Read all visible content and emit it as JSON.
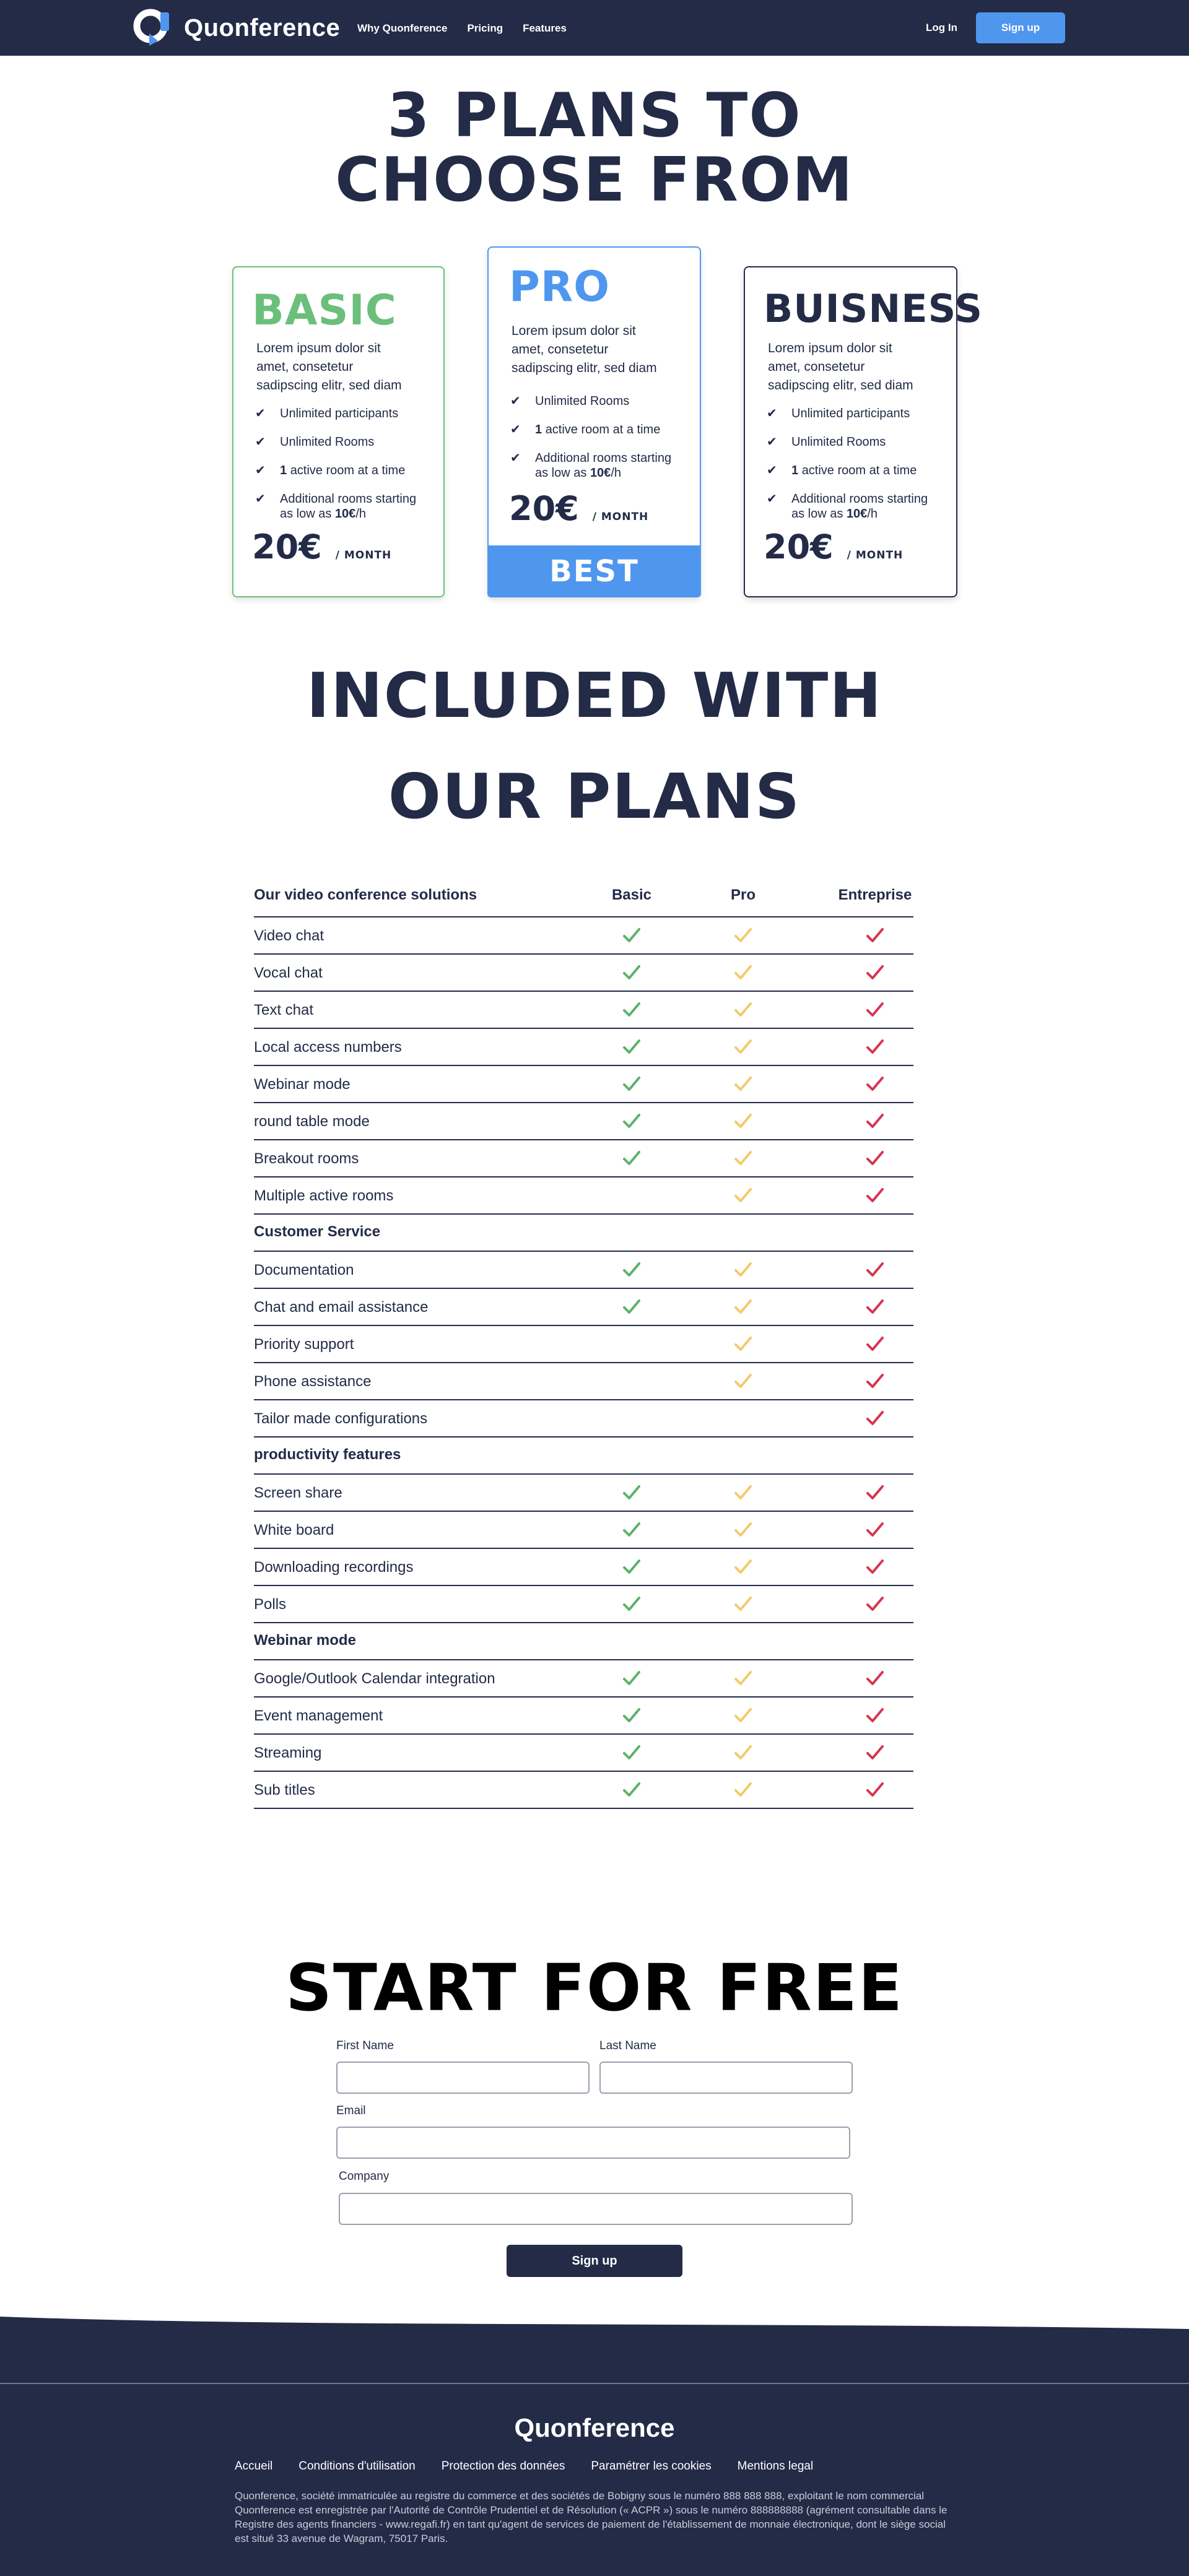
{
  "header": {
    "brand": "Quonference",
    "nav": [
      "Why Quonference",
      "Pricing",
      "Features"
    ],
    "login": "Log In",
    "signup": "Sign up"
  },
  "plans_title": [
    "3 PLANS TO",
    "CHOOSE FROM"
  ],
  "plans": [
    {
      "name": "BASIC",
      "color": "#6bbf7b",
      "desc": [
        "Lorem ipsum dolor sit",
        "amet, consetetur",
        "sadipscing elitr, sed diam"
      ],
      "features": [
        "Unlimited participants",
        "Unlimited Rooms",
        "active room at a time",
        "Additional rooms starting",
        "as low as",
        "/h"
      ],
      "bold_one": "1",
      "bold_price": "10€",
      "price": "20€",
      "per": "/ MONTH"
    },
    {
      "name": "PRO",
      "color": "#4f97ee",
      "desc": [
        "Lorem ipsum dolor sit",
        "amet, consetetur",
        "sadipscing elitr, sed diam"
      ],
      "features": [
        "Unlimited Rooms",
        "active room at a time",
        "Additional rooms starting",
        "as low as",
        "/h"
      ],
      "bold_one": "1",
      "bold_price": "10€",
      "price": "20€",
      "per": "/ MONTH",
      "badge": "BEST VALUE"
    },
    {
      "name": "BUISNESS",
      "color": "#232b47",
      "desc": [
        "Lorem ipsum dolor sit",
        "amet, consetetur",
        "sadipscing elitr, sed diam"
      ],
      "features": [
        "Unlimited participants",
        "Unlimited Rooms",
        "active room at a time",
        "Additional rooms starting",
        "as low as",
        "/h"
      ],
      "bold_one": "1",
      "bold_price": "10€",
      "price": "20€",
      "per": "/ MONTH"
    }
  ],
  "included_title": [
    "INCLUDED WITH",
    "OUR PLANS"
  ],
  "table": {
    "columns": [
      "Basic",
      "Pro",
      "Entreprise"
    ],
    "check_colors": [
      "#5cb26a",
      "#f5c96a",
      "#d8344f"
    ],
    "sections": [
      {
        "title": "Our video conference solutions",
        "is_header": true,
        "rows": [
          {
            "label": "Video chat",
            "checks": [
              true,
              true,
              true
            ]
          },
          {
            "label": "Vocal chat",
            "checks": [
              true,
              true,
              true
            ]
          },
          {
            "label": "Text chat",
            "checks": [
              true,
              true,
              true
            ]
          },
          {
            "label": "Local access numbers",
            "checks": [
              true,
              true,
              true
            ]
          },
          {
            "label": "Webinar mode",
            "checks": [
              true,
              true,
              true
            ]
          },
          {
            "label": "round table mode",
            "checks": [
              true,
              true,
              true
            ]
          },
          {
            "label": "Breakout rooms",
            "checks": [
              true,
              true,
              true
            ]
          },
          {
            "label": "Multiple active rooms",
            "checks": [
              false,
              true,
              true
            ]
          }
        ]
      },
      {
        "title": "Customer Service",
        "rows": [
          {
            "label": "Documentation",
            "checks": [
              true,
              true,
              true
            ]
          },
          {
            "label": "Chat and email assistance",
            "checks": [
              true,
              true,
              true
            ]
          },
          {
            "label": "Priority support",
            "checks": [
              false,
              true,
              true
            ]
          },
          {
            "label": "Phone assistance",
            "checks": [
              false,
              true,
              true
            ]
          },
          {
            "label": "Tailor made configurations",
            "checks": [
              false,
              false,
              true
            ]
          }
        ]
      },
      {
        "title": "productivity features",
        "rows": [
          {
            "label": "Screen share",
            "checks": [
              true,
              true,
              true
            ]
          },
          {
            "label": "White board",
            "checks": [
              true,
              true,
              true
            ]
          },
          {
            "label": "Downloading recordings",
            "checks": [
              true,
              true,
              true
            ]
          },
          {
            "label": "Polls",
            "checks": [
              true,
              true,
              true
            ]
          }
        ]
      },
      {
        "title": "Webinar mode",
        "rows": [
          {
            "label": "Google/Outlook Calendar integration",
            "checks": [
              true,
              true,
              true
            ]
          },
          {
            "label": "Event management",
            "checks": [
              true,
              true,
              true
            ]
          },
          {
            "label": "Streaming",
            "checks": [
              true,
              true,
              true
            ]
          },
          {
            "label": "Sub titles",
            "checks": [
              true,
              true,
              true
            ]
          }
        ]
      }
    ]
  },
  "form": {
    "title": "START FOR FREE",
    "first_name": "First Name",
    "last_name": "Last Name",
    "email": "Email",
    "company": "Company",
    "submit": "Sign up"
  },
  "footer": {
    "brand": "Quonference",
    "links": [
      "Accueil",
      "Conditions d'utilisation",
      "Protection des données",
      "Paramétrer les cookies",
      "Mentions legal"
    ],
    "legal": "Quonference, société immatriculée au registre du commerce et des sociétés de Bobigny sous le numéro 888 888 888, exploitant le nom commercial Quonference est enregistrée par l'Autorité de Contrôle Prudentiel et de Résolution (« ACPR ») sous le numéro 888888888 (agrément consultable dans le Registre des agents financiers - www.regafi.fr) en tant qu'agent de services de paiement de l'établissement de monnaie électronique, dont le siège social est situé 33 avenue de Wagram, 75017 Paris.",
    "bg": "#232b47"
  }
}
